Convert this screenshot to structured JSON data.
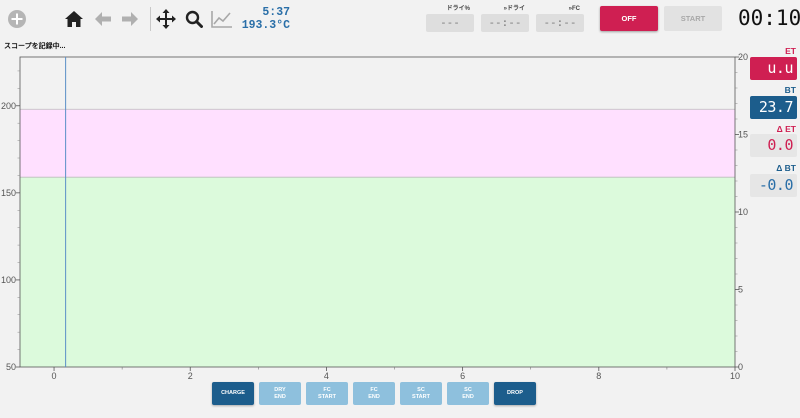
{
  "toolbar": {
    "icons": [
      "add-icon",
      "home-icon",
      "back-arrow-icon",
      "forward-arrow-icon",
      "move-icon",
      "zoom-icon",
      "chart-icon"
    ]
  },
  "readout": {
    "time": "5:37",
    "temp": "193.3°C"
  },
  "phases": [
    {
      "label": "ドライ%",
      "value": "---"
    },
    {
      "label": "»ドライ",
      "value": "--:--"
    },
    {
      "label": "»FC",
      "value": "--:--"
    }
  ],
  "controls": {
    "off_label": "OFF",
    "start_label": "START",
    "timer": "00:10"
  },
  "status": "スコープを記録中...",
  "lcds": {
    "et": {
      "label": "ET",
      "value": "u.u"
    },
    "bt": {
      "label": "BT",
      "value": "23.7"
    },
    "det": {
      "label": "Δ ET",
      "value": "0.0"
    },
    "dbt": {
      "label": "Δ BT",
      "value": "-0.0"
    }
  },
  "events": [
    {
      "label": "CHARGE",
      "style": "primary"
    },
    {
      "label": "DRY\nEND",
      "style": "muted"
    },
    {
      "label": "FC\nSTART",
      "style": "muted"
    },
    {
      "label": "FC\nEND",
      "style": "muted"
    },
    {
      "label": "SC\nSTART",
      "style": "muted"
    },
    {
      "label": "SC\nEND",
      "style": "muted"
    },
    {
      "label": "DROP",
      "style": "primary"
    }
  ],
  "colors": {
    "accent_red": "#cf1f52",
    "accent_blue": "#1c5d8c",
    "band_upper": "#ffe0ff",
    "band_lower": "#dcfadc",
    "cursor_line": "#5a8fc7"
  },
  "chart_data": {
    "type": "line",
    "x_ticks": [
      "0",
      "2",
      "4",
      "6",
      "8",
      "10"
    ],
    "y_left_ticks": [
      "50",
      "100",
      "150",
      "200"
    ],
    "y_right_ticks": [
      "0",
      "5",
      "10",
      "15",
      "20"
    ],
    "xlim": [
      -0.5,
      10
    ],
    "ylim_left": [
      50,
      228
    ],
    "ylim_right": [
      0,
      20
    ],
    "bands": [
      {
        "y_from": 159,
        "y_to": 198,
        "color": "#ffe0ff"
      },
      {
        "y_from": 50,
        "y_to": 159,
        "color": "#dcfadc"
      }
    ],
    "cursor_x": 0.17,
    "grid": false,
    "series": []
  }
}
